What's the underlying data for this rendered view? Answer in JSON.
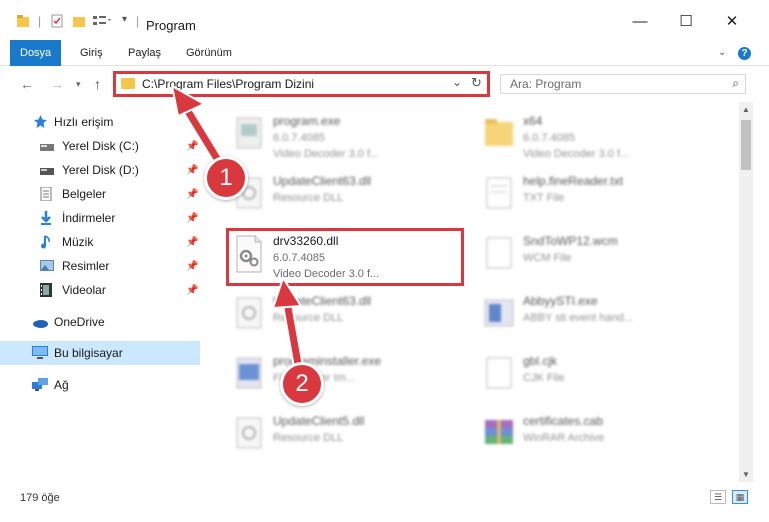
{
  "window": {
    "title": "Program",
    "minimize": "—",
    "maximize": "☐",
    "close": "✕"
  },
  "ribbon": {
    "tabs": [
      "Dosya",
      "Giriş",
      "Paylaş",
      "Görünüm"
    ],
    "help": "?"
  },
  "address": {
    "path": "C:\\Program Files\\Program Dizini",
    "search_placeholder": "Ara: Program"
  },
  "nav": {
    "items": [
      {
        "label": "Hızlı erişim",
        "icon": "star-icon",
        "pinned": false
      },
      {
        "label": "Yerel Disk (C:)",
        "icon": "drive-icon",
        "pinned": true
      },
      {
        "label": "Yerel Disk (D:)",
        "icon": "drive-icon",
        "pinned": true
      },
      {
        "label": "Belgeler",
        "icon": "documents-icon",
        "pinned": true
      },
      {
        "label": "İndirmeler",
        "icon": "download-icon",
        "pinned": true
      },
      {
        "label": "Müzik",
        "icon": "music-icon",
        "pinned": true
      },
      {
        "label": "Resimler",
        "icon": "pictures-icon",
        "pinned": true
      },
      {
        "label": "Videolar",
        "icon": "videos-icon",
        "pinned": true
      },
      {
        "label": "OneDrive",
        "icon": "cloud-icon",
        "pinned": false
      },
      {
        "label": "Bu bilgisayar",
        "icon": "computer-icon",
        "pinned": false
      },
      {
        "label": "Ağ",
        "icon": "network-icon",
        "pinned": false
      }
    ]
  },
  "files": {
    "left": [
      {
        "name": "program.exe",
        "meta1": "6.0.7.4085",
        "meta2": "Video Decoder 3.0 f..."
      },
      {
        "name": "UpdateClient63.dll",
        "meta1": "Resource DLL",
        "meta2": ""
      },
      {
        "name": "drv33260.dll",
        "meta1": "6.0.7.4085",
        "meta2": "Video Decoder 3.0 f..."
      },
      {
        "name": "UpdateClient63.dll",
        "meta1": "Resource DLL",
        "meta2": ""
      },
      {
        "name": "programinstaller.exe",
        "meta1": "Fineimaster Im...",
        "meta2": ""
      },
      {
        "name": "UpdateClient5.dll",
        "meta1": "Resource DLL",
        "meta2": ""
      }
    ],
    "right": [
      {
        "name": "x64",
        "meta1": "6.0.7.4085",
        "meta2": "Video Decoder 3.0 f..."
      },
      {
        "name": "help.fineReader.txt",
        "meta1": "TXT File",
        "meta2": ""
      },
      {
        "name": "SndToWP12.wcm",
        "meta1": "WCM File",
        "meta2": ""
      },
      {
        "name": "AbbyySTI.exe",
        "meta1": "ABBY sti event hand...",
        "meta2": ""
      },
      {
        "name": "gbl.cjk",
        "meta1": "CJK File",
        "meta2": ""
      },
      {
        "name": "certificates.cab",
        "meta1": "WinRAR Archive",
        "meta2": ""
      }
    ]
  },
  "status": {
    "count": "179 öğe"
  },
  "annotations": {
    "step1": "1",
    "step2": "2"
  }
}
